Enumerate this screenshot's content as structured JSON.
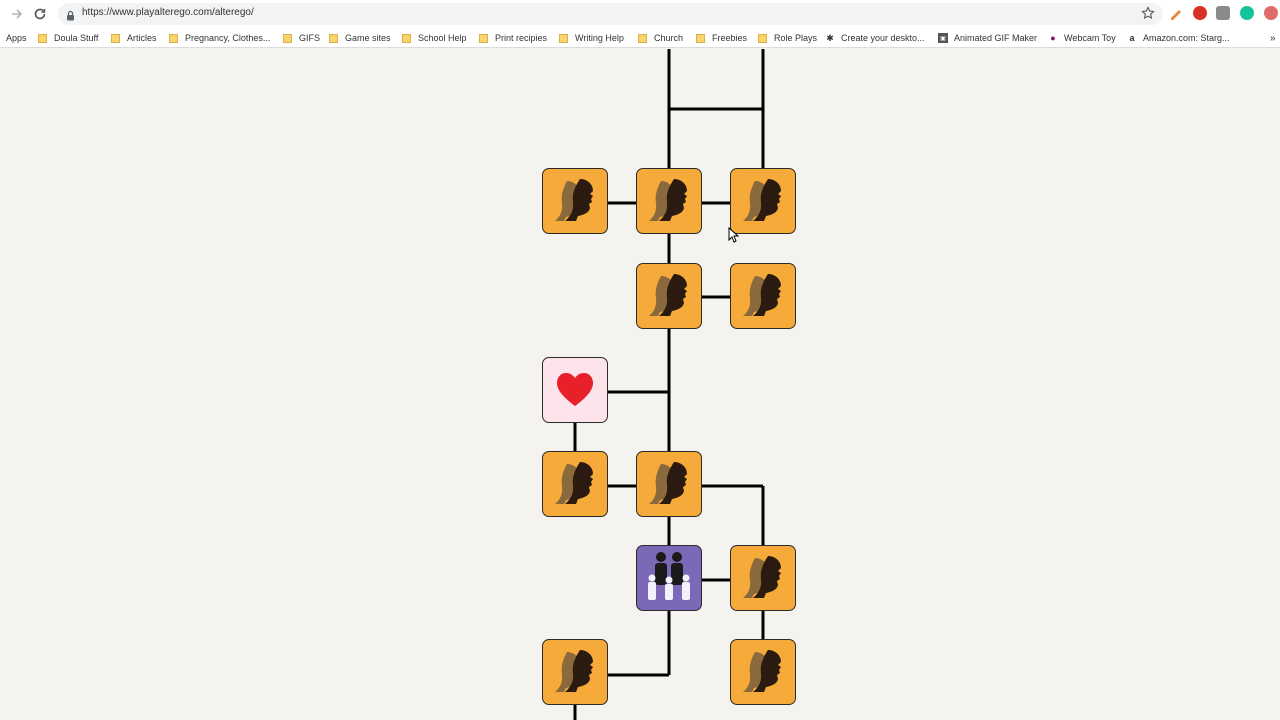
{
  "browser": {
    "url": "https://www.playalterego.com/alterego/",
    "bookmarks": [
      {
        "label": "Apps",
        "icon": "apps-grid-icon"
      },
      {
        "label": "Doula Stuff",
        "icon": "folder-icon"
      },
      {
        "label": "Articles",
        "icon": "folder-icon"
      },
      {
        "label": "Pregnancy, Clothes...",
        "icon": "folder-icon"
      },
      {
        "label": "GIFS",
        "icon": "folder-icon"
      },
      {
        "label": "Game sites",
        "icon": "folder-icon"
      },
      {
        "label": "School Help",
        "icon": "folder-icon"
      },
      {
        "label": "Print recipies",
        "icon": "folder-icon"
      },
      {
        "label": "Writing Help",
        "icon": "folder-icon"
      },
      {
        "label": "Church",
        "icon": "folder-icon"
      },
      {
        "label": "Freebies",
        "icon": "folder-icon"
      },
      {
        "label": "Role Plays",
        "icon": "folder-icon"
      },
      {
        "label": "Create your deskto...",
        "icon": "gear-icon"
      },
      {
        "label": "Animated GIF Maker",
        "icon": "gif-icon"
      },
      {
        "label": "Webcam Toy",
        "icon": "webcam-icon"
      },
      {
        "label": "Amazon.com: Starg...",
        "icon": "amazon-icon"
      }
    ]
  },
  "tree": {
    "nodes": [
      {
        "id": "grandparent",
        "type": "person"
      },
      {
        "id": "sibling-1",
        "type": "person"
      },
      {
        "id": "parent-line-top",
        "type": "person"
      },
      {
        "id": "parent-spouse-top",
        "type": "person"
      },
      {
        "id": "self",
        "type": "person"
      },
      {
        "id": "spouse",
        "type": "person"
      },
      {
        "id": "relationship-heart",
        "type": "heart"
      },
      {
        "id": "partner-left",
        "type": "person"
      },
      {
        "id": "child-1",
        "type": "person"
      },
      {
        "id": "family-group",
        "type": "family"
      },
      {
        "id": "child-spouse",
        "type": "person"
      },
      {
        "id": "grandchild-left",
        "type": "person"
      },
      {
        "id": "grandchild-right",
        "type": "person"
      }
    ],
    "colors": {
      "person": "#f5aa3a",
      "heart": "#fde4ea",
      "family": "#7b68b6",
      "line": "#000000",
      "background": "#f4f3ef"
    }
  }
}
